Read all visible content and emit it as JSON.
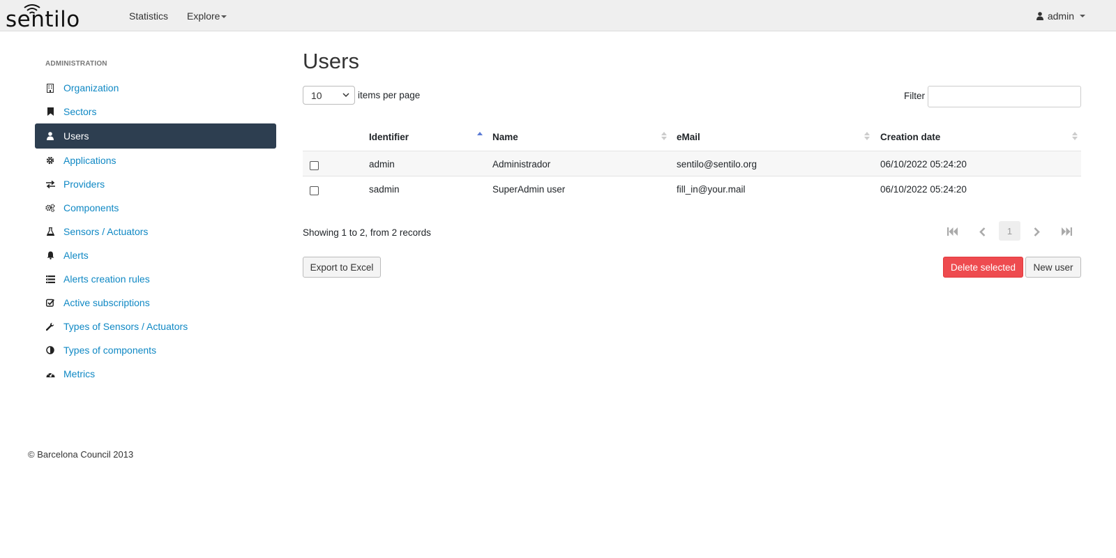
{
  "brand": {
    "name": "sentilo"
  },
  "navbar": {
    "statistics": "Statistics",
    "explore": "Explore",
    "user": "admin"
  },
  "sidebar": {
    "title": "ADMINISTRATION",
    "items": [
      {
        "label": "Organization",
        "icon": "building-icon"
      },
      {
        "label": "Sectors",
        "icon": "bookmark-icon"
      },
      {
        "label": "Users",
        "icon": "user-icon",
        "active": true
      },
      {
        "label": "Applications",
        "icon": "gear-icon"
      },
      {
        "label": "Providers",
        "icon": "exchange-icon"
      },
      {
        "label": "Components",
        "icon": "gears-icon"
      },
      {
        "label": "Sensors / Actuators",
        "icon": "flask-icon"
      },
      {
        "label": "Alerts",
        "icon": "bell-icon"
      },
      {
        "label": "Alerts creation rules",
        "icon": "list-icon"
      },
      {
        "label": "Active subscriptions",
        "icon": "check-square-icon"
      },
      {
        "label": "Types of Sensors / Actuators",
        "icon": "wrench-icon"
      },
      {
        "label": "Types of components",
        "icon": "half-circle-icon"
      },
      {
        "label": "Metrics",
        "icon": "dashboard-icon"
      }
    ]
  },
  "main": {
    "title": "Users",
    "per_page_value": "10",
    "per_page_label": "items per page",
    "filter_label": "Filter",
    "filter_value": "",
    "columns": [
      "Identifier",
      "Name",
      "eMail",
      "Creation date"
    ],
    "rows": [
      {
        "identifier": "admin",
        "name": "Administrador",
        "email": "sentilo@sentilo.org",
        "created": "06/10/2022 05:24:20"
      },
      {
        "identifier": "sadmin",
        "name": "SuperAdmin user",
        "email": "fill_in@your.mail",
        "created": "06/10/2022 05:24:20"
      }
    ],
    "showing": "Showing 1 to 2, from 2 records",
    "current_page": "1",
    "export_label": "Export to Excel",
    "delete_label": "Delete selected",
    "new_label": "New user"
  },
  "colors": {
    "link": "#0f88c4",
    "active_bg": "#2d3e50",
    "danger": "#ee4b4f"
  },
  "footer": {
    "text": "© Barcelona Council 2013"
  }
}
